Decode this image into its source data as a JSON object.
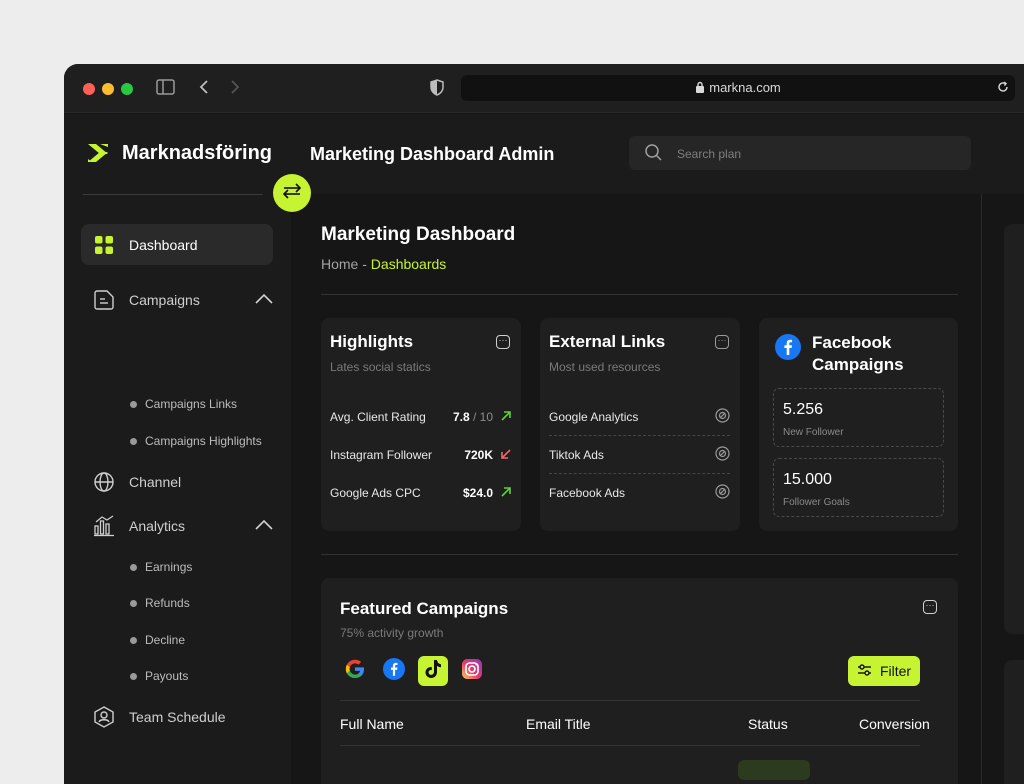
{
  "browser": {
    "url": "markna.com"
  },
  "app": {
    "brand": "Marknadsföring",
    "header_title": "Marketing Dashboard Admin",
    "accent": "#c6f432"
  },
  "search": {
    "placeholder": "Search plan"
  },
  "sidebar": {
    "items": [
      {
        "label": "Dashboard"
      },
      {
        "label": "Campaigns",
        "sub": [
          "Campaigns Links",
          "Campaigns Highlights"
        ]
      },
      {
        "label": "Channel"
      },
      {
        "label": "Analytics",
        "sub": [
          "Earnings",
          "Refunds",
          "Decline",
          "Payouts"
        ]
      },
      {
        "label": "Team Schedule"
      }
    ]
  },
  "main": {
    "title": "Marketing Dashboard",
    "breadcrumb": {
      "home": "Home - ",
      "current": "Dashboards"
    }
  },
  "highlights": {
    "title": "Highlights",
    "subtitle": "Lates social statics",
    "rows": [
      {
        "label": "Avg. Client Rating",
        "value": "7.8",
        "denominator": " / 10",
        "trend": "up"
      },
      {
        "label": "Instagram Follower",
        "value": "720K",
        "denominator": "",
        "trend": "down"
      },
      {
        "label": "Google Ads CPC",
        "value": "$24.0",
        "denominator": "",
        "trend": "up"
      }
    ]
  },
  "external_links": {
    "title": "External Links",
    "subtitle": "Most used resources",
    "rows": [
      {
        "label": "Google Analytics"
      },
      {
        "label": "Tiktok Ads"
      },
      {
        "label": "Facebook Ads"
      }
    ]
  },
  "facebook": {
    "title_line1": "Facebook",
    "title_line2": "Campaigns",
    "stats": [
      {
        "value": "5.256",
        "label": "New Follower"
      },
      {
        "value": "15.000",
        "label": "Follower Goals"
      }
    ]
  },
  "featured": {
    "title": "Featured Campaigns",
    "subtitle": "75% activity growth",
    "filter_label": "Filter",
    "columns": [
      "Full Name",
      "Email Title",
      "Status",
      "Conversion"
    ]
  }
}
